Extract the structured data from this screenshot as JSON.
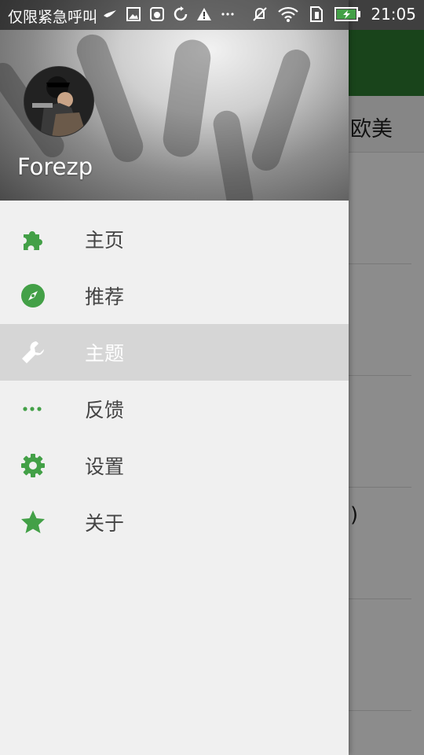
{
  "status_bar": {
    "carrier": "仅限紧急呼叫",
    "time": "21:05"
  },
  "background_app": {
    "tab_label": "欧美",
    "partial_text": ")"
  },
  "drawer": {
    "username": "Forezp",
    "items": [
      {
        "label": "主页",
        "icon": "puzzle-icon",
        "active": false
      },
      {
        "label": "推荐",
        "icon": "compass-icon",
        "active": false
      },
      {
        "label": "主题",
        "icon": "wrench-icon",
        "active": true
      },
      {
        "label": "反馈",
        "icon": "more-dots-icon",
        "active": false
      },
      {
        "label": "设置",
        "icon": "gear-icon",
        "active": false
      },
      {
        "label": "关于",
        "icon": "star-icon",
        "active": false
      }
    ]
  },
  "colors": {
    "accent": "#43a047",
    "toolbar": "#2e7d32",
    "active_row": "#d6d6d6",
    "drawer_bg": "#f0f0f0"
  }
}
